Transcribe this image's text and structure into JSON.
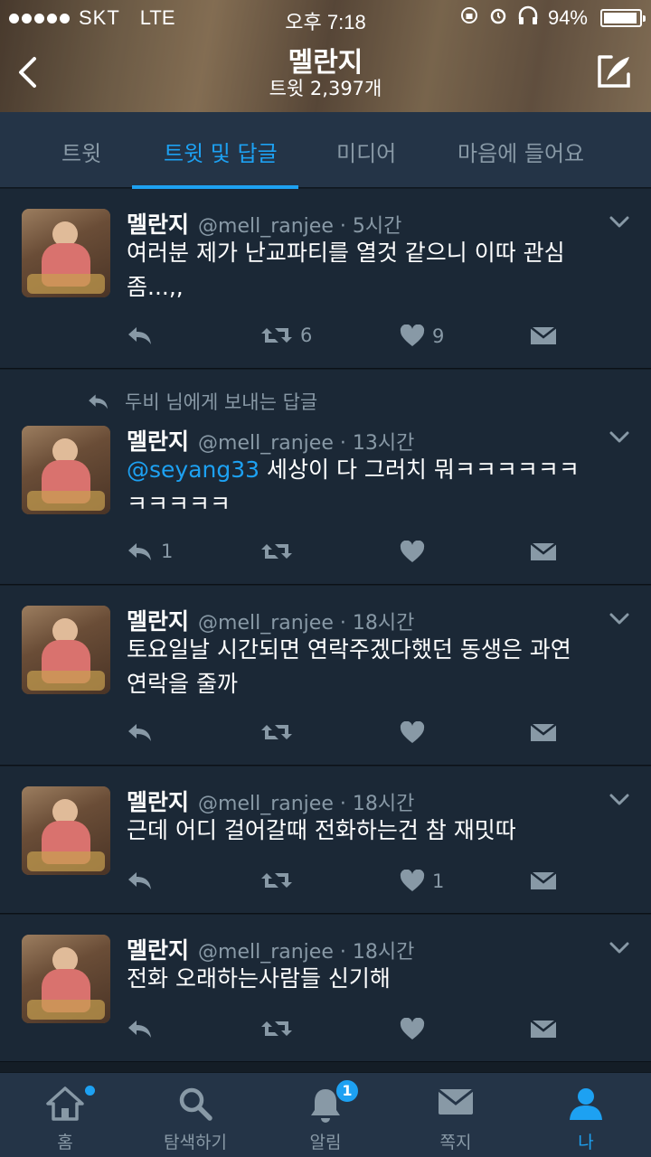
{
  "status_bar": {
    "carrier": "SKT",
    "network": "LTE",
    "time": "오후 7:18",
    "battery": "94%",
    "battery_level": 0.94
  },
  "header": {
    "title": "멜란지",
    "subtitle": "트윗 2,397개"
  },
  "tabs": [
    "트윗",
    "트윗 및 답글",
    "미디어",
    "마음에 들어요"
  ],
  "active_tab": "트윗 및 답글",
  "tweets": [
    {
      "name": "멜란지",
      "handle": "@mell_ranjee · 5시간",
      "text": "여러분 제가 난교파티를 열것 같으니 이따 관심",
      "text2": "좀...,,",
      "reply_count": "",
      "retweet_count": "6",
      "like_count": "9"
    },
    {
      "reply_context": "두비 님에게 보내는 답글",
      "name": "멜란지",
      "handle": "@mell_ranjee · 13시간",
      "mention": "@seyang33",
      "text": " 세상이 다 그러치 뭐ㅋㅋㅋㅋㅋㅋ",
      "text2": "ㅋㅋㅋㅋㅋ",
      "reply_count": "1",
      "retweet_count": "",
      "like_count": ""
    },
    {
      "name": "멜란지",
      "handle": "@mell_ranjee · 18시간",
      "text": "토요일날 시간되면 연락주겠다했던 동생은 과연",
      "text2": "연락을 줄까",
      "reply_count": "",
      "retweet_count": "",
      "like_count": ""
    },
    {
      "name": "멜란지",
      "handle": "@mell_ranjee · 18시간",
      "text": "근데 어디 걸어갈때 전화하는건 참 재밋따",
      "text2": "",
      "reply_count": "",
      "retweet_count": "",
      "like_count": "1"
    },
    {
      "name": "멜란지",
      "handle": "@mell_ranjee · 18시간",
      "text": "전화 오래하는사람들 신기해",
      "text2": "",
      "reply_count": "",
      "retweet_count": "",
      "like_count": ""
    }
  ],
  "tabbar": {
    "items": [
      "홈",
      "탐색하기",
      "알림",
      "쪽지",
      "나"
    ],
    "notification_badge": "1",
    "active": "나"
  },
  "colors": {
    "accent": "#1da1f2",
    "background": "#1b2836",
    "secondary_text": "#8899a6"
  }
}
